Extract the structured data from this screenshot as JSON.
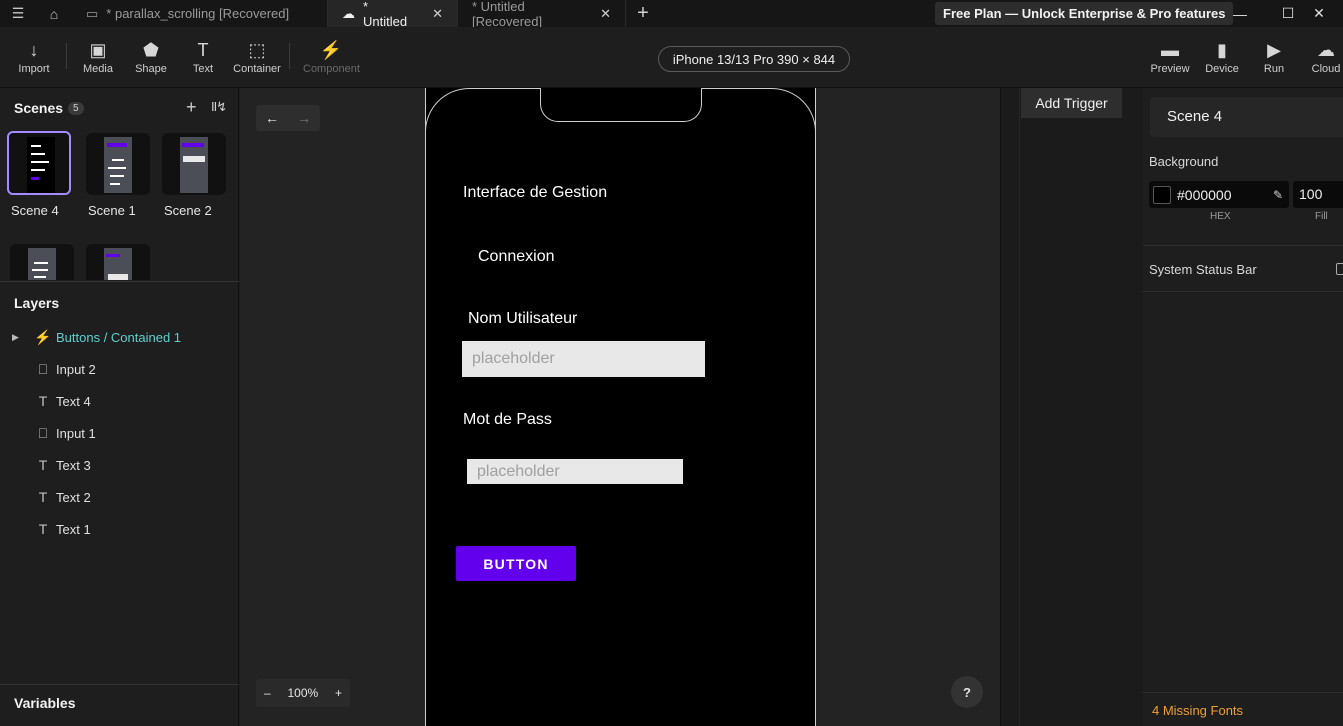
{
  "titlebar": {
    "tabs": [
      {
        "label": "* parallax_scrolling [Recovered]",
        "active": false
      },
      {
        "label": "* Untitled",
        "active": true
      },
      {
        "label": "* Untitled [Recovered]",
        "active": false
      }
    ],
    "promo": "Free Plan — Unlock Enterprise & Pro features",
    "close_glyph": "✕",
    "add_glyph": "+"
  },
  "toolbar": {
    "tools": [
      {
        "label": "Import",
        "icon": "↓"
      },
      {
        "label": "Media",
        "icon": "▣"
      },
      {
        "label": "Shape",
        "icon": "⬟"
      },
      {
        "label": "Text",
        "icon": "T"
      },
      {
        "label": "Container",
        "icon": "⬚"
      },
      {
        "label": "Component",
        "icon": "⚡"
      }
    ],
    "device": "iPhone 13/13 Pro  390 × 844",
    "right_tools": [
      {
        "label": "Preview",
        "icon": "▬"
      },
      {
        "label": "Device",
        "icon": "▮"
      },
      {
        "label": "Run",
        "icon": "▶"
      },
      {
        "label": "Cloud",
        "icon": "☁"
      }
    ]
  },
  "scenes": {
    "title": "Scenes",
    "count": "5",
    "items": [
      {
        "label": "Scene 4",
        "selected": true
      },
      {
        "label": "Scene 1",
        "selected": false
      },
      {
        "label": "Scene 2",
        "selected": false
      }
    ]
  },
  "layers": {
    "title": "Layers",
    "items": [
      {
        "label": "Buttons / Contained 1",
        "icon": "lightning-icon"
      },
      {
        "label": "Input 2",
        "icon": "input-icon"
      },
      {
        "label": "Text 4",
        "icon": "text-icon"
      },
      {
        "label": "Input 1",
        "icon": "input-icon"
      },
      {
        "label": "Text 3",
        "icon": "text-icon"
      },
      {
        "label": "Text 2",
        "icon": "text-icon"
      },
      {
        "label": "Text 1",
        "icon": "text-icon"
      }
    ]
  },
  "variables": {
    "title": "Variables"
  },
  "canvas": {
    "zoom": "100%",
    "zoom_minus": "–",
    "zoom_plus": "+",
    "help": "?",
    "nav_back": "←",
    "nav_forward": "→"
  },
  "phone": {
    "title": "Interface de Gestion",
    "subtitle": "Connexion",
    "username_label": "Nom Utilisateur",
    "username_placeholder": "placeholder",
    "password_label": "Mot de Pass",
    "password_placeholder": "placeholder",
    "button_label": "BUTTON"
  },
  "trigger": {
    "add_label": "Add Trigger"
  },
  "inspector": {
    "scene_name": "Scene 4",
    "background_label": "Background",
    "hex_value": "#000000",
    "fill_value": "100",
    "hex_caption": "HEX",
    "fill_caption": "Fill",
    "status_bar_label": "System Status Bar",
    "missing_fonts": "4 Missing Fonts"
  },
  "colors": {
    "accent": "#6200ee",
    "selection": "#a48bff",
    "component": "#5ed0d0",
    "warning": "#f0a030"
  }
}
